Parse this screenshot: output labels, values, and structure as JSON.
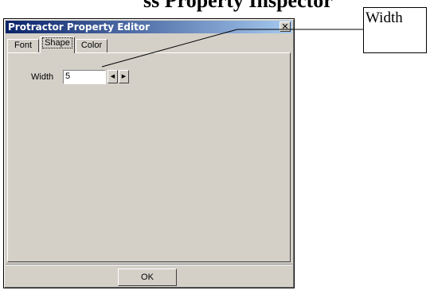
{
  "background_text": "ss Property Inspector",
  "window": {
    "title": "Protractor Property Editor",
    "close_label": "✕"
  },
  "tabs": [
    {
      "label": "Font",
      "active": false
    },
    {
      "label": "Shape",
      "active": true
    },
    {
      "label": "Color",
      "active": false
    }
  ],
  "shape_panel": {
    "width_label": "Width",
    "width_value": "5"
  },
  "buttons": {
    "ok_label": "OK"
  },
  "callout": {
    "text": "Width"
  }
}
